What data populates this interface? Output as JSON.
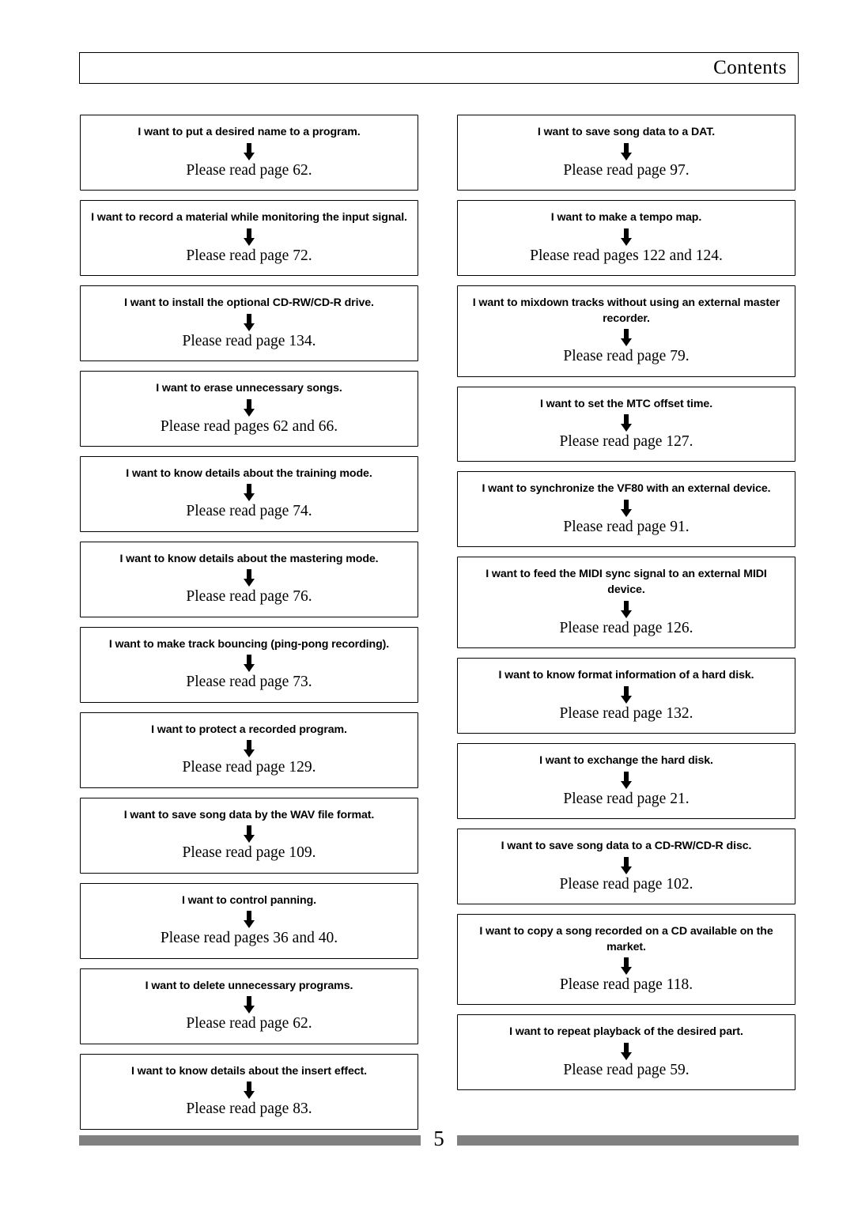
{
  "header": {
    "title": "Contents"
  },
  "left_column": [
    {
      "question": "I want to put a desired name to a program.",
      "answer": "Please read page 62."
    },
    {
      "question": "I want to record a material while monitoring the input signal.",
      "answer": "Please read page 72."
    },
    {
      "question": "I want to install the optional CD-RW/CD-R drive.",
      "answer": "Please read page 134."
    },
    {
      "question": "I want to erase unnecessary songs.",
      "answer": "Please read pages 62 and 66."
    },
    {
      "question": "I want to know details about the training mode.",
      "answer": "Please read page 74."
    },
    {
      "question": "I want to know details about the mastering mode.",
      "answer": "Please read page 76."
    },
    {
      "question": "I want to make track bouncing (ping-pong recording).",
      "answer": "Please read page 73."
    },
    {
      "question": "I want to protect a recorded program.",
      "answer": "Please read page 129."
    },
    {
      "question": "I want to save song data by the WAV file format.",
      "answer": "Please read page 109."
    },
    {
      "question": "I want to control panning.",
      "answer": "Please read pages 36 and 40."
    },
    {
      "question": "I want to delete unnecessary programs.",
      "answer": "Please read page 62."
    },
    {
      "question": "I want to know details about the insert effect.",
      "answer": "Please read page 83."
    }
  ],
  "right_column": [
    {
      "question": "I want to save song data to a DAT.",
      "answer": "Please read page 97."
    },
    {
      "question": "I want to make a tempo map.",
      "answer": "Please read pages 122 and 124."
    },
    {
      "question": "I want to mixdown tracks without using an external master recorder.",
      "answer": "Please read page 79."
    },
    {
      "question": "I want to set the MTC offset time.",
      "answer": "Please read page 127."
    },
    {
      "question": "I want to synchronize the VF80 with an external device.",
      "answer": "Please read page 91."
    },
    {
      "question": "I want to feed the MIDI sync signal to an external MIDI device.",
      "answer": "Please read page 126."
    },
    {
      "question": "I want to know format information of a hard disk.",
      "answer": "Please read page 132."
    },
    {
      "question": "I want to exchange the hard disk.",
      "answer": "Please read page 21."
    },
    {
      "question": "I want to save song data to a CD-RW/CD-R disc.",
      "answer": "Please read page 102."
    },
    {
      "question": "I want to copy a song recorded on a CD available on the market.",
      "answer": "Please read page 118."
    },
    {
      "question": "I want to repeat playback of the desired part.",
      "answer": "Please read page 59."
    }
  ],
  "footer": {
    "page_number": "5",
    "rule_color": "#808080"
  }
}
